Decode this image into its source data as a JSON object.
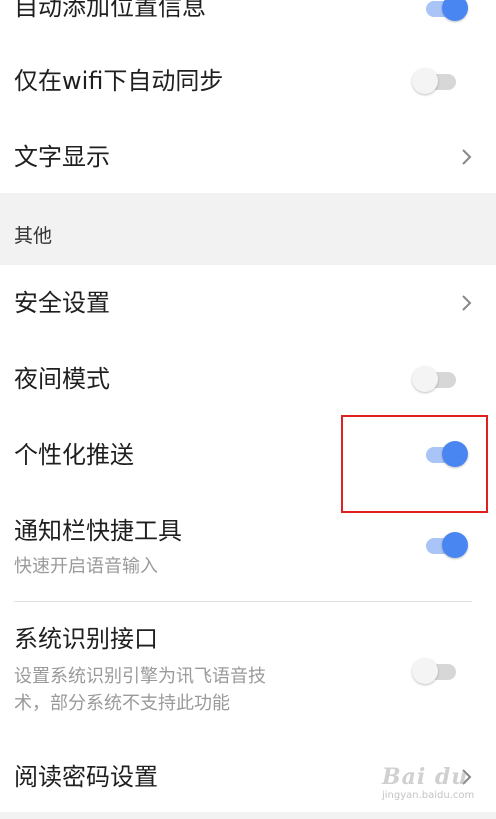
{
  "rows": {
    "auto_location": {
      "label": "自动添加位置信息",
      "state": "on"
    },
    "wifi_sync": {
      "label": "仅在wifi下自动同步",
      "state": "off"
    },
    "text_display": {
      "label": "文字显示"
    },
    "other_section": {
      "title": "其他"
    },
    "security": {
      "label": "安全设置"
    },
    "night_mode": {
      "label": "夜间模式",
      "state": "off"
    },
    "personal_push": {
      "label": "个性化推送",
      "state": "on"
    },
    "notif_shortcut": {
      "label": "通知栏快捷工具",
      "sub": "快速开启语音输入",
      "state": "on"
    },
    "system_recog": {
      "label": "系统识别接口",
      "sub_line1": "设置系统识别引擎为讯飞语音技",
      "sub_line2": "术，部分系统不支持此功能",
      "state": "off"
    },
    "read_password": {
      "label": "阅读密码设置"
    }
  },
  "watermark": {
    "text": "Bai du",
    "sub": "jingyan.baidu.com"
  },
  "colors": {
    "toggle_on": "#4a86f2",
    "toggle_on_track": "#a9c4f7",
    "toggle_off": "#f4f4f4",
    "highlight": "#e02020",
    "section_bg": "#f2f2f2"
  }
}
